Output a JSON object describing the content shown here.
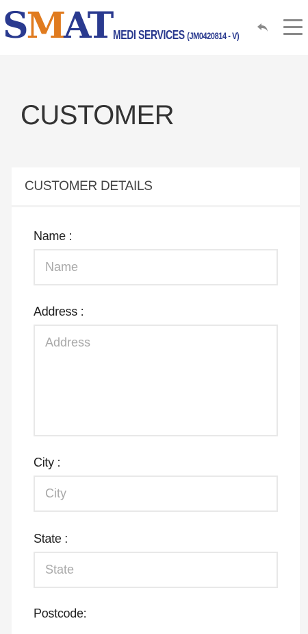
{
  "header": {
    "logo_text_left": "S",
    "logo_text_accent": "M",
    "logo_text_right": "AT",
    "logo_subtitle": "MEDI SERVICES",
    "logo_code": "(JM0420814 - V)",
    "back_icon": "reply-arrow-icon",
    "menu_icon": "hamburger-menu-icon"
  },
  "page": {
    "title": "CUSTOMER"
  },
  "card": {
    "title": "CUSTOMER DETAILS",
    "fields": {
      "name": {
        "label": "Name :",
        "placeholder": "Name",
        "value": ""
      },
      "address": {
        "label": "Address :",
        "placeholder": "Address",
        "value": ""
      },
      "city": {
        "label": "City :",
        "placeholder": "City",
        "value": ""
      },
      "state": {
        "label": "State :",
        "placeholder": "State",
        "value": ""
      },
      "postcode": {
        "label": "Postcode:"
      }
    }
  },
  "colors": {
    "brand_blue": "#2a3a8f",
    "brand_orange": "#e07b1f",
    "background": "#f5f5f5"
  }
}
